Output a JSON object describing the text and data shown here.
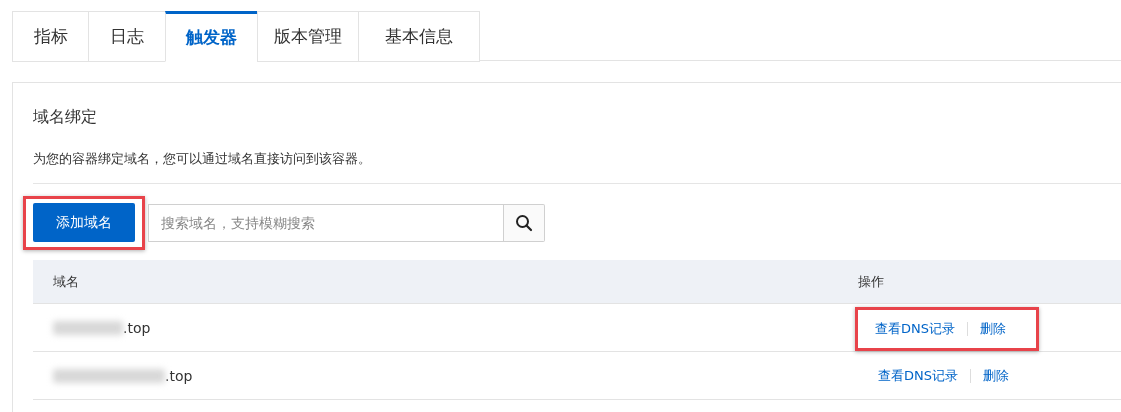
{
  "tabs": [
    {
      "label": "指标",
      "selected": false
    },
    {
      "label": "日志",
      "selected": false
    },
    {
      "label": "触发器",
      "selected": true
    },
    {
      "label": "版本管理",
      "selected": false
    },
    {
      "label": "基本信息",
      "selected": false
    }
  ],
  "section": {
    "title": "域名绑定",
    "description": "为您的容器绑定域名，您可以通过域名直接访问到该容器。"
  },
  "toolbar": {
    "add_button": {
      "label": "添加域名",
      "highlighted": true
    },
    "search": {
      "placeholder": "搜索域名，支持模糊搜索"
    }
  },
  "table": {
    "columns": [
      "域名",
      "操作"
    ],
    "rows": [
      {
        "domain": ".top",
        "redacted": true,
        "actions": [
          "查看DNS记录",
          "删除"
        ],
        "highlighted": true
      },
      {
        "domain": ".top",
        "redacted": true,
        "actions": [
          "查看DNS记录",
          "删除"
        ],
        "highlighted": false
      }
    ]
  }
}
